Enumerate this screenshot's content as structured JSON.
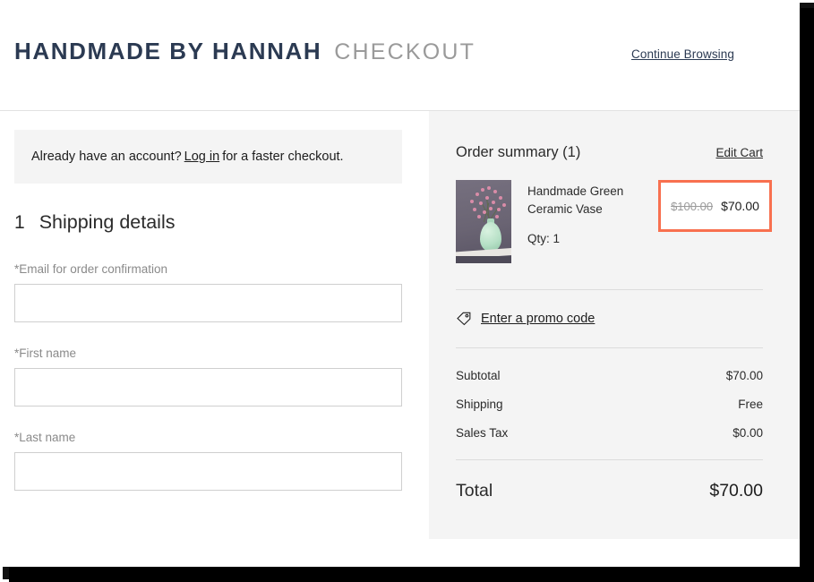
{
  "header": {
    "brand": "HANDMADE BY HANNAH",
    "section": "CHECKOUT",
    "continue_browsing": "Continue Browsing"
  },
  "login_banner": {
    "prefix": "Already have an account?",
    "link": "Log in",
    "suffix": "for a faster checkout."
  },
  "shipping": {
    "step_number": "1",
    "title": "Shipping details",
    "fields": [
      {
        "label": "*Email for order confirmation",
        "value": "",
        "placeholder": ""
      },
      {
        "label": "*First name",
        "value": "",
        "placeholder": ""
      },
      {
        "label": "*Last name",
        "value": "",
        "placeholder": ""
      }
    ]
  },
  "summary": {
    "title": "Order summary (1)",
    "edit_cart": "Edit Cart",
    "item": {
      "name": "Handmade Green Ceramic Vase",
      "qty": "Qty: 1",
      "price_original": "$100.00",
      "price_current": "$70.00",
      "thumbnail_alt": "green ceramic vase with pink blossoms"
    },
    "promo": {
      "icon": "tag-icon",
      "label": "Enter a promo code"
    },
    "lines": [
      {
        "label": "Subtotal",
        "value": "$70.00"
      },
      {
        "label": "Shipping",
        "value": "Free"
      },
      {
        "label": "Sales Tax",
        "value": "$0.00"
      }
    ],
    "total": {
      "label": "Total",
      "value": "$70.00"
    }
  },
  "colors": {
    "brand_navy": "#2b3a52",
    "section_gray": "#9a9a9a",
    "highlight_coral": "#f8704f",
    "panel_gray": "#f4f4f4",
    "banner_gray": "#f4f4f4",
    "text_dark": "#2b2b2b",
    "label_gray": "#8a8a8a"
  }
}
